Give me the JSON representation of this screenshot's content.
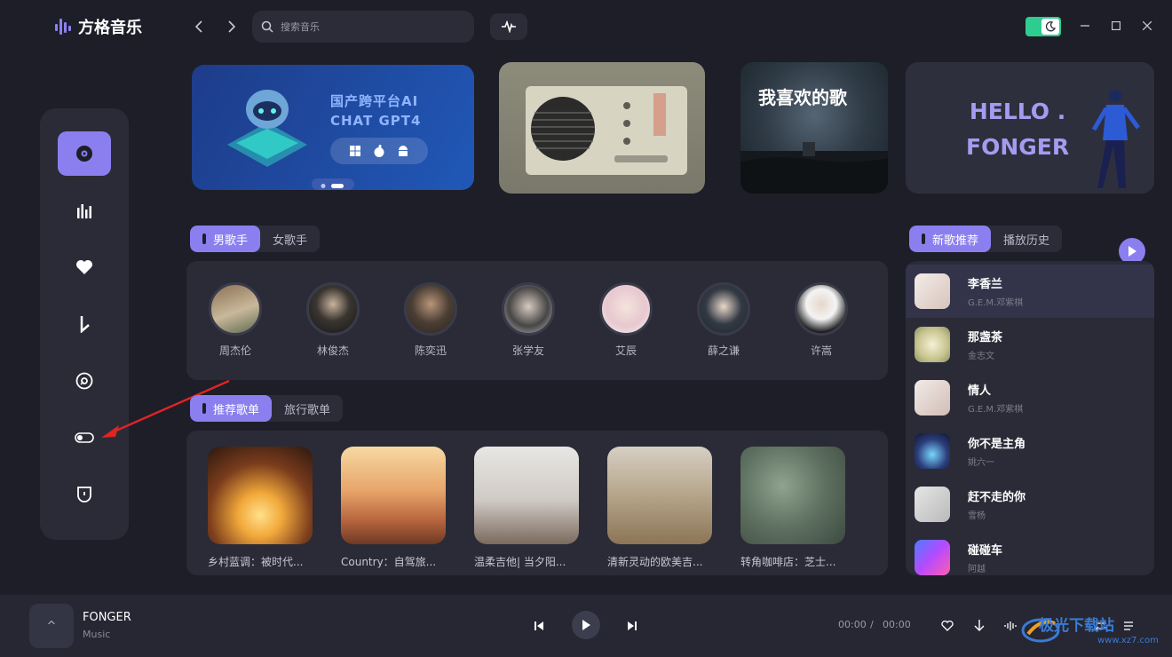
{
  "app": {
    "name": "方格音乐"
  },
  "search": {
    "placeholder": "搜索音乐"
  },
  "banners": {
    "ai_title_line1": "国产跨平台AI",
    "ai_title_line2": "CHAT GPT4",
    "fav_title": "我喜欢的歌",
    "hello_line1": "HELLO .",
    "hello_line2": "FONGER"
  },
  "singer_tabs": [
    "男歌手",
    "女歌手"
  ],
  "artists": [
    "周杰伦",
    "林俊杰",
    "陈奕迅",
    "张学友",
    "艾辰",
    "薛之谦",
    "许嵩"
  ],
  "playlist_tabs": [
    "推荐歌单",
    "旅行歌单"
  ],
  "playlists": [
    "乡村蓝调：被时代...",
    "Country：自驾旅...",
    "温柔吉他| 当夕阳...",
    "清新灵动的欧美吉...",
    "转角咖啡店：芝士..."
  ],
  "song_tabs": [
    "新歌推荐",
    "播放历史"
  ],
  "songs": [
    {
      "title": "李香兰",
      "artist": "G.E.M.邓紫棋"
    },
    {
      "title": "那盏茶",
      "artist": "金志文"
    },
    {
      "title": "情人",
      "artist": "G.E.M.邓紫棋"
    },
    {
      "title": "你不是主角",
      "artist": "姚六一"
    },
    {
      "title": "赶不走的你",
      "artist": "雪杨"
    },
    {
      "title": "碰碰车",
      "artist": "阿越"
    }
  ],
  "player": {
    "cover_glyph": "^",
    "title": "FONGER",
    "subtitle": "Music",
    "current_time": "00:00",
    "separator": "/",
    "total_time": "00:00"
  },
  "watermark": {
    "text": "极光下载站",
    "url": "www.xz7.com"
  },
  "colors": {
    "accent": "#8b7ff0",
    "toggle": "#2ecc8f",
    "annotation": "#e02424"
  }
}
